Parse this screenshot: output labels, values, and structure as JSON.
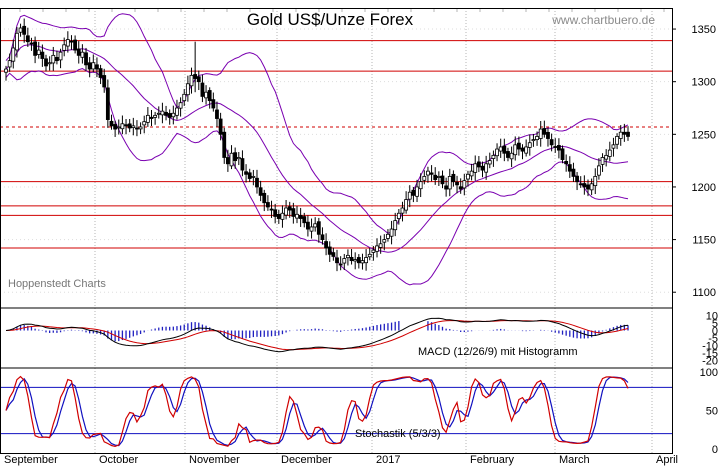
{
  "chart_data": {
    "type": "candlestick",
    "title": "Gold US$/Unze Forex",
    "website": "www.chartbuero.de",
    "source": "Hoppenstedt Charts",
    "months": [
      "September",
      "October",
      "November",
      "December",
      "2017",
      "February",
      "March",
      "April"
    ],
    "colors": {
      "background": "#ffffff",
      "grid": "#b4b4b4",
      "resistance_lines": "#d00000",
      "bollinger": "#7a00b0",
      "candle": "#000000",
      "macd_line": "#000000",
      "macd_signal": "#d00000",
      "macd_hist": "#2020c0",
      "stoch_k": "#d00000",
      "stoch_d": "#1010c0",
      "stoch_levels": "#1010c0"
    },
    "price_panel": {
      "ylim": [
        1085,
        1370
      ],
      "ticks": [
        1100,
        1150,
        1200,
        1250,
        1300,
        1350
      ],
      "horizontal_levels": [
        {
          "value": 1339,
          "style": "solid"
        },
        {
          "value": 1310,
          "style": "solid"
        },
        {
          "value": 1257,
          "style": "dashed"
        },
        {
          "value": 1205,
          "style": "solid"
        },
        {
          "value": 1182,
          "style": "solid"
        },
        {
          "value": 1173,
          "style": "solid"
        },
        {
          "value": 1142,
          "style": "solid"
        }
      ],
      "close_series": [
        1312,
        1320,
        1332,
        1346,
        1351,
        1345,
        1338,
        1336,
        1325,
        1330,
        1322,
        1315,
        1318,
        1325,
        1320,
        1328,
        1335,
        1340,
        1338,
        1330,
        1325,
        1328,
        1316,
        1312,
        1318,
        1312,
        1304,
        1295,
        1264,
        1258,
        1255,
        1257,
        1260,
        1258,
        1256,
        1258,
        1255,
        1257,
        1262,
        1268,
        1265,
        1268,
        1270,
        1272,
        1268,
        1266,
        1270,
        1275,
        1280,
        1288,
        1298,
        1306,
        1303,
        1300,
        1286,
        1290,
        1282,
        1275,
        1265,
        1250,
        1228,
        1222,
        1232,
        1225,
        1228,
        1216,
        1212,
        1208,
        1210,
        1200,
        1192,
        1185,
        1181,
        1178,
        1172,
        1170,
        1175,
        1180,
        1178,
        1172,
        1174,
        1170,
        1166,
        1160,
        1162,
        1165,
        1155,
        1150,
        1142,
        1136,
        1134,
        1128,
        1126,
        1132,
        1135,
        1130,
        1131,
        1128,
        1130,
        1133,
        1136,
        1140,
        1144,
        1146,
        1150,
        1155,
        1160,
        1168,
        1175,
        1180,
        1188,
        1195,
        1192,
        1200,
        1205,
        1210,
        1215,
        1212,
        1207,
        1210,
        1203,
        1198,
        1210,
        1205,
        1202,
        1198,
        1206,
        1212,
        1215,
        1222,
        1219,
        1216,
        1222,
        1225,
        1230,
        1236,
        1238,
        1232,
        1228,
        1232,
        1240,
        1236,
        1234,
        1238,
        1242,
        1245,
        1248,
        1255,
        1250,
        1246,
        1240,
        1238,
        1235,
        1226,
        1222,
        1215,
        1210,
        1205,
        1203,
        1200,
        1198,
        1203,
        1210,
        1220,
        1228,
        1230,
        1235,
        1240,
        1248,
        1252,
        1250,
        1248
      ]
    },
    "macd_panel": {
      "label": "MACD (12/26/9) mit Histogramm",
      "ylim": [
        -25,
        15
      ],
      "ticks": [
        10,
        5,
        0,
        -5,
        -10,
        -15,
        -20
      ]
    },
    "stoch_panel": {
      "label": "Stochastik (5/3/3)",
      "ylim": [
        -5,
        105
      ],
      "ticks": [
        100,
        50,
        0
      ],
      "levels": [
        80,
        20
      ]
    }
  }
}
